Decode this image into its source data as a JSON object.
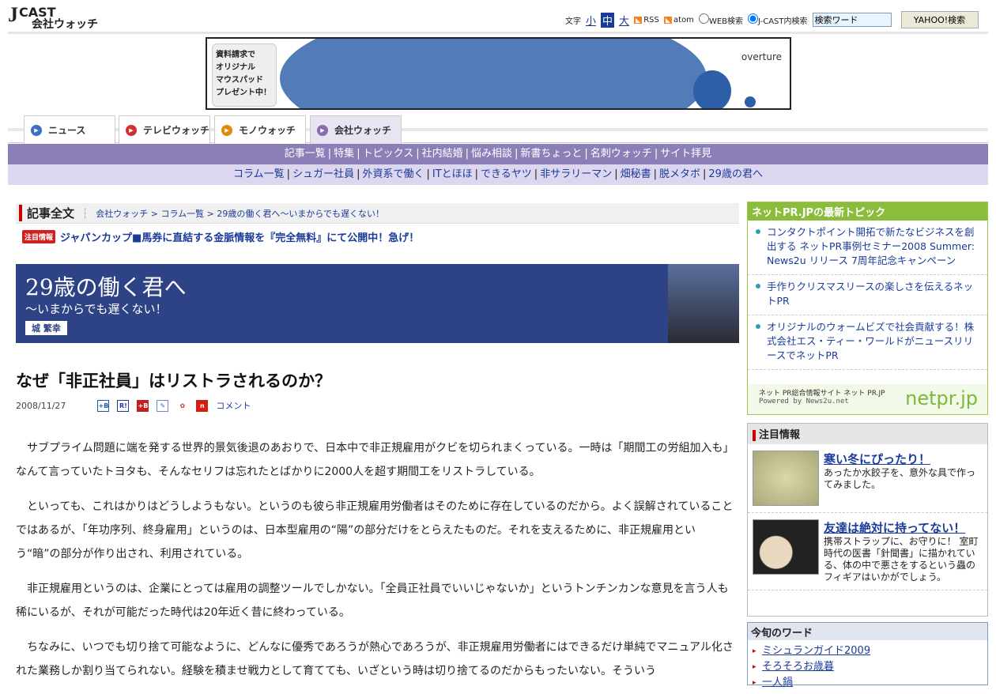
{
  "header": {
    "logo_top": "CAST",
    "logo_bottom": "会社ウォッチ",
    "font_label": "文字",
    "sizes": [
      "小",
      "中",
      "大"
    ],
    "rss": "RSS",
    "atom": "atom",
    "radio_web": "WEB検索",
    "radio_jcast": "J-CAST内検索",
    "search_value": "検索ワード",
    "search_button": "YAHOO!検索"
  },
  "ad": {
    "text": [
      "資料請求で",
      "オリジナル",
      "マウスパッド",
      "プレゼント中！"
    ],
    "brand": "overture"
  },
  "tabs": [
    {
      "label": "ニュース",
      "color": "#3a6fc4"
    },
    {
      "label": "テレビウォッチ",
      "color": "#d03030"
    },
    {
      "label": "モノウォッチ",
      "color": "#e08a10"
    },
    {
      "label": "会社ウォッチ",
      "color": "#8a6ab0"
    }
  ],
  "nav1": [
    "記事一覧",
    "特集",
    "トピックス",
    "社内結婚",
    "悩み相談",
    "新書ちょっと",
    "名刺ウォッチ",
    "サイト拝見"
  ],
  "nav2": [
    "コラム一覧",
    "シュガー社員",
    "外資系で働く",
    "ITとほほ",
    "できるヤツ",
    "非サラリーマン",
    "畑秘書",
    "脱メタボ",
    "29歳の君へ"
  ],
  "crumb": {
    "title": "記事全文",
    "path": "会社ウォッチ > コラム一覧 > 29歳の働く君へ～いまからでも遅くない！"
  },
  "notice": {
    "badge": "注目情報",
    "text": "ジャパンカップ■馬券に直結する金脈情報を『完全無料』にて公開中！急げ！"
  },
  "banner": {
    "title": "29歳の働く君へ",
    "subtitle": "～いまからでも遅くない！",
    "author": "城 繁幸"
  },
  "article": {
    "title": "なぜ「非正社員」はリストラされるのか？",
    "date": "2008/11/27",
    "comment": "コメント",
    "paragraphs": [
      "サブプライム問題に端を発する世界的景気後退のあおりで、日本中で非正規雇用がクビを切られまくっている。一時は「期間工の労組加入も」なんて言っていたトヨタも、そんなセリフは忘れたとばかりに2000人を超す期間工をリストラしている。",
      "といっても、これはかりはどうしようもない。というのも彼ら非正規雇用労働者はそのために存在しているのだから。よく誤解されていることではあるが、「年功序列、終身雇用」というのは、日本型雇用の“陽”の部分だけをとらえたものだ。それを支えるために、非正規雇用という“暗”の部分が作り出され、利用されている。",
      "非正規雇用というのは、企業にとっては雇用の調整ツールでしかない。「全員正社員でいいじゃないか」というトンチンカンな意見を言う人も稀にいるが、それが可能だった時代は20年近く昔に終わっている。",
      "ちなみに、いつでも切り捨て可能なように、どんなに優秀であろうが熱心であろうが、非正規雇用労働者にはできるだけ単純でマニュアル化された業務しか割り当てられない。経験を積ませ戦力として育てても、いざという時は切り捨てるのだからもったいない。そういう"
    ]
  },
  "sidebar": {
    "pr": {
      "heading": "ネットPR.JPの最新トピック",
      "items": [
        "コンタクトポイント開拓で新たなビジネスを創出する ネットPR事例セミナー2008 Summer: News2u リリース 7周年記念キャンペーン",
        "手作りクリスマスリースの楽しさを伝えるネットPR",
        "オリジナルのウォームビズで社会貢献する！株式会社エス・ティー・ワールドがニュースリリースでネットPR"
      ],
      "footer": "ネット PR総合情報サイト ネット PR.JP",
      "powered": "Powered by News2u.net",
      "logo": "netpr.jp"
    },
    "hot": {
      "heading": "注目情報",
      "items": [
        {
          "title": "寒い冬にぴったり！",
          "desc": "あったか水餃子を、意外な具で作ってみました。"
        },
        {
          "title": "友達は絶対に持ってない！",
          "desc": "携帯ストラップに、お守りに！ 室町時代の医書「針聞書」に描かれている、体の中で悪さをするという蟲のフィギアはいかがでしょう。"
        }
      ]
    },
    "words": {
      "heading": "今旬のワード",
      "items": [
        "ミシュランガイド2009",
        "そろそろお歳暮",
        "一人鍋"
      ]
    }
  }
}
